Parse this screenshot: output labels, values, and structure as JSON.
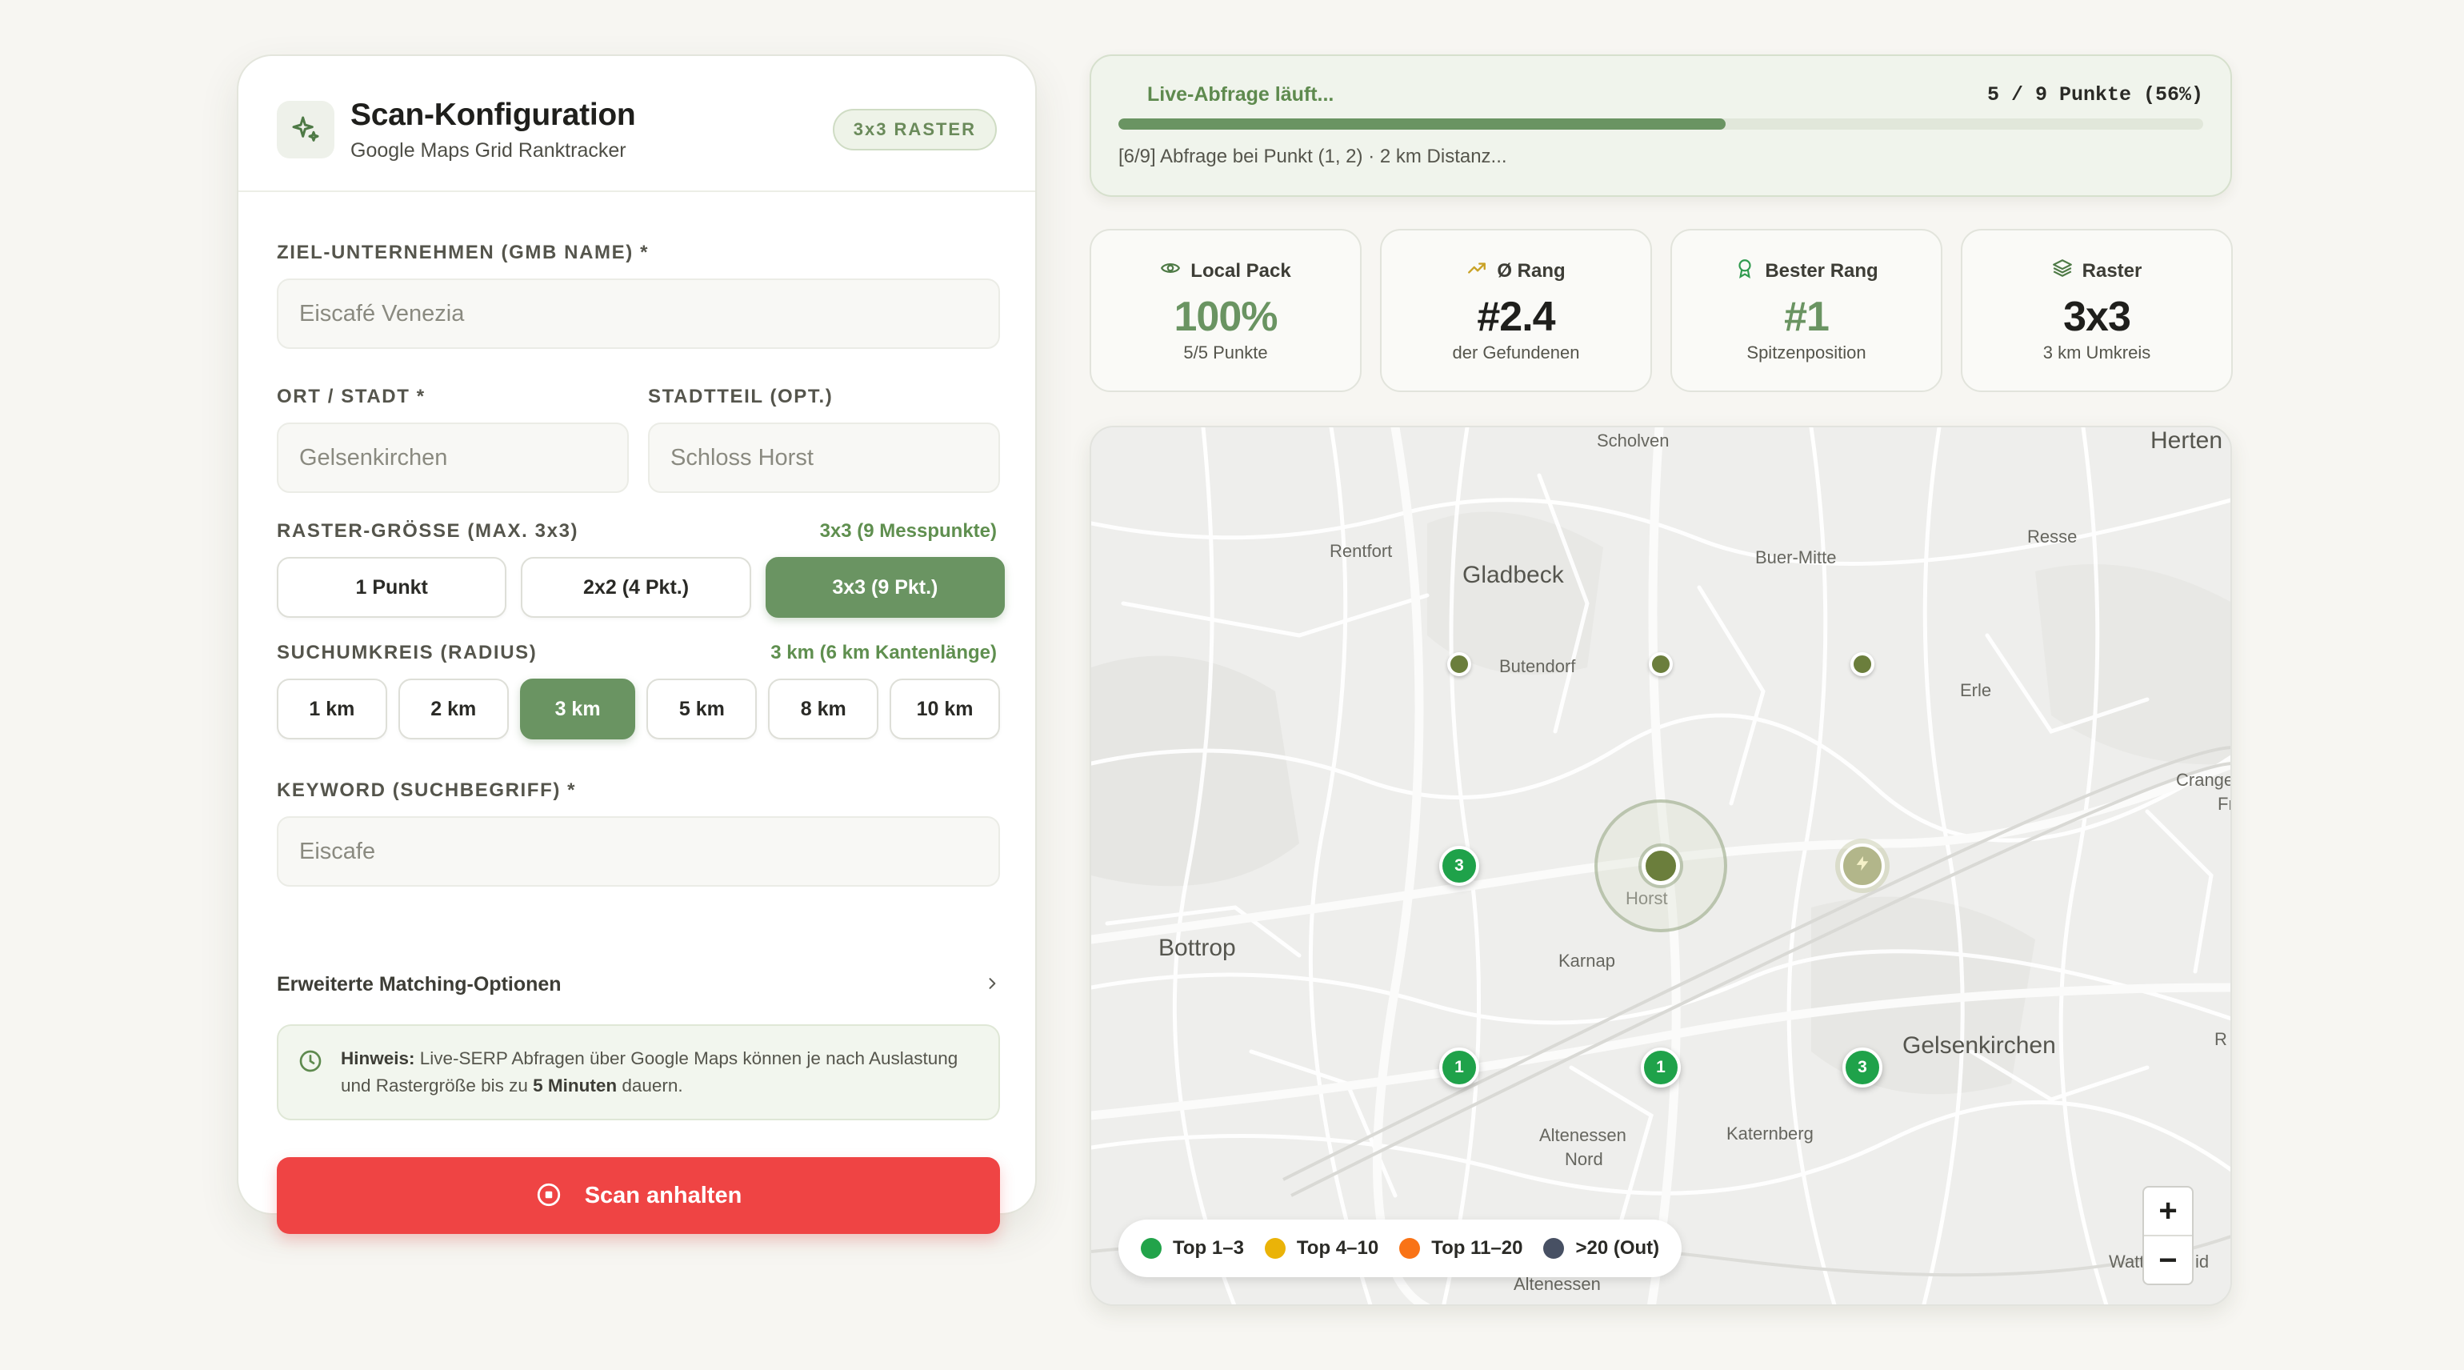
{
  "config": {
    "title": "Scan-Konfiguration",
    "subtitle": "Google Maps Grid Ranktracker",
    "badge": "3x3 RASTER",
    "business_label": "ZIEL-UNTERNEHMEN (GMB NAME) *",
    "business_placeholder": "Eiscafé Venezia",
    "city_label": "ORT / STADT *",
    "city_placeholder": "Gelsenkirchen",
    "district_label": "STADTTEIL (OPT.)",
    "district_placeholder": "Schloss Horst",
    "grid_label": "RASTER-GRÖSSE (MAX. 3x3)",
    "grid_hint": "3x3 (9 Messpunkte)",
    "grid_options": [
      "1 Punkt",
      "2x2 (4 Pkt.)",
      "3x3 (9 Pkt.)"
    ],
    "grid_selected_index": 2,
    "radius_label": "SUCHUMKREIS (RADIUS)",
    "radius_hint": "3 km (6 km Kantenlänge)",
    "radius_options": [
      "1 km",
      "2 km",
      "3 km",
      "5 km",
      "8 km",
      "10 km"
    ],
    "radius_selected_index": 2,
    "keyword_label": "KEYWORD (SUCHBEGRIFF) *",
    "keyword_placeholder": "Eiscafe",
    "advanced_label": "Erweiterte Matching-Optionen",
    "notice_bold": "Hinweis:",
    "notice_text": " Live-SERP Abfragen über Google Maps können je nach Auslastung und Rastergröße bis zu ",
    "notice_bold2": "5 Minuten",
    "notice_end": " dauern.",
    "stop_label": "Scan anhalten"
  },
  "progress": {
    "label": "Live-Abfrage läuft...",
    "count": "5 / 9 Punkte (56%)",
    "fraction": 0.56,
    "status": "[6/9] Abfrage bei Punkt (1, 2) · 2 km Distanz..."
  },
  "stats": [
    {
      "title": "Local Pack",
      "value": "100%",
      "sub": "5/5 Punkte",
      "icon": "eye-icon",
      "green": true
    },
    {
      "title": "Ø Rang",
      "value": "#2.4",
      "sub": "der Gefundenen",
      "icon": "trending-up-icon",
      "green": false
    },
    {
      "title": "Bester Rang",
      "value": "#1",
      "sub": "Spitzenposition",
      "icon": "award-icon",
      "green": true
    },
    {
      "title": "Raster",
      "value": "3x3",
      "sub": "3 km Umkreis",
      "icon": "layers-icon",
      "green": false
    }
  ],
  "map": {
    "places": {
      "scholven": "Scholven",
      "herten": "Herten",
      "rentfort": "Rentfort",
      "gladbeck": "Gladbeck",
      "buer_mitte": "Buer-Mitte",
      "resse": "Resse",
      "butendorf": "Butendorf",
      "erle": "Erle",
      "crange": "Crange",
      "fr": "Fr",
      "horst": "Horst",
      "bottrop": "Bottrop",
      "karnap": "Karnap",
      "gelsenkirchen": "Gelsenkirchen",
      "r": "R",
      "altenessen_nord": "Altenessen",
      "nord": "Nord",
      "katernberg": "Katernberg",
      "altenessen": "Altenessen",
      "watte": "Watte",
      "id": "id"
    },
    "pins": [
      {
        "rank": "3",
        "label": "3"
      },
      {
        "rank": "1",
        "label": "1"
      },
      {
        "rank": "1",
        "label": "1"
      },
      {
        "rank": "3",
        "label": "3"
      }
    ],
    "legend": [
      "Top 1–3",
      "Top 4–10",
      "Top 11–20",
      ">20 (Out)"
    ],
    "legend_colors": [
      "#22a34a",
      "#eab308",
      "#f97316",
      "#475063"
    ],
    "zoom_in": "+",
    "zoom_out": "−"
  },
  "colors": {
    "accent": "#6a9462",
    "stop": "#ef4444",
    "pin_green": "#1fa24a"
  }
}
